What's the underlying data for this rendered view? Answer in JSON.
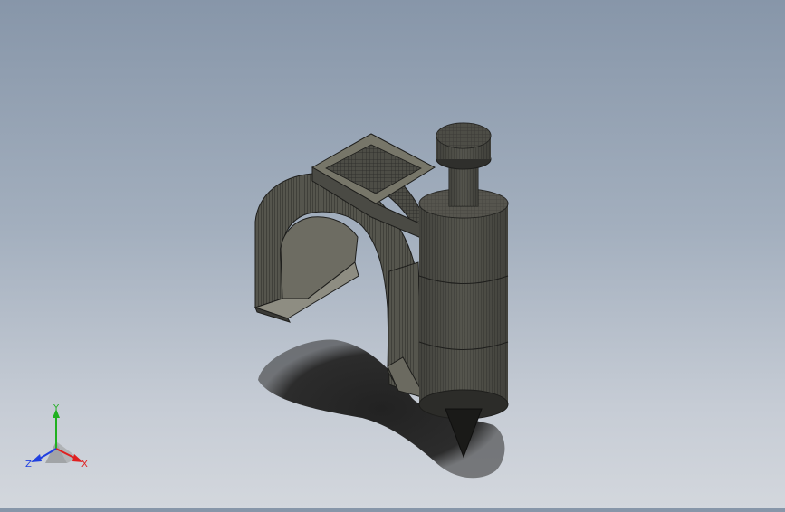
{
  "viewport": {
    "model": "cable-clip-with-nail"
  },
  "triad": {
    "x_label": "X",
    "y_label": "Y",
    "z_label": "Z",
    "x_color": "#e02020",
    "y_color": "#20b020",
    "z_color": "#2040e0"
  },
  "colors": {
    "background_top": "#8796a9",
    "background_bottom": "#d3d7dd",
    "model_dark": "#3a3a36",
    "model_mid": "#6b6a60",
    "model_light": "#8e8d82",
    "shadow": "#2f2f2f"
  }
}
